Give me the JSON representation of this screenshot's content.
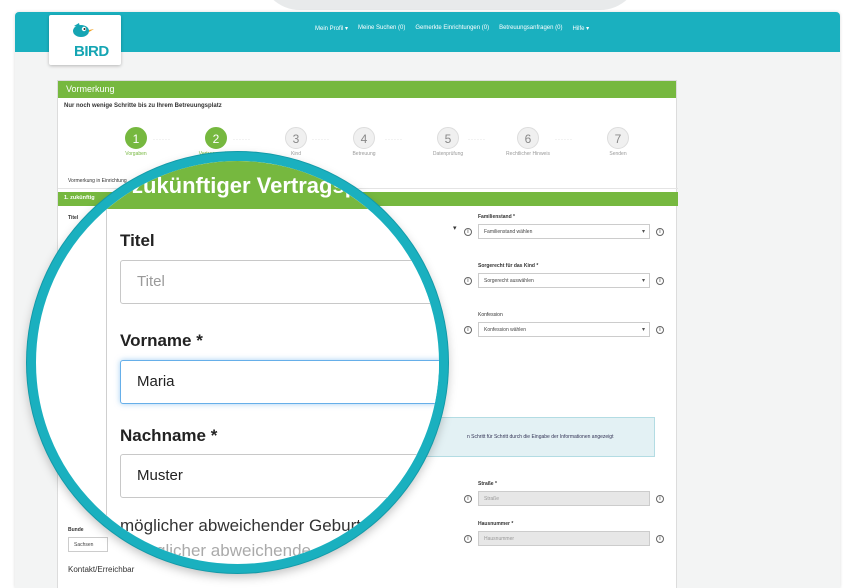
{
  "nav": {
    "logo_text": "BIRD",
    "links": [
      "Mein Profil ▾",
      "Meine Suchen (0)",
      "Gemerkte Einrichtungen (0)",
      "Betreuungsanfragen (0)",
      "Hilfe ▾"
    ]
  },
  "panel": {
    "title": "Vormerkung",
    "subtitle": "Nur noch wenige Schritte bis zu Ihrem Betreuungsplatz",
    "steps": [
      {
        "num": "1",
        "label": "Vorgaben",
        "done": true
      },
      {
        "num": "2",
        "label": "Vertragspartner",
        "done": true
      },
      {
        "num": "3",
        "label": "Kind",
        "done": false
      },
      {
        "num": "4",
        "label": "Betreuung",
        "done": false
      },
      {
        "num": "5",
        "label": "Datenprüfung",
        "done": false
      },
      {
        "num": "6",
        "label": "Rechtlicher Hinweis",
        "done": false
      },
      {
        "num": "7",
        "label": "Senden",
        "done": false
      }
    ],
    "dots": "······",
    "tab": "Vormerkung in Einrichtung",
    "section": "1. zukünftig",
    "left_label_titel": "Titel",
    "bundesland_label": "Bunde",
    "bundesland_value": "Sachsen",
    "kontakt_label": "Kontakt/Erreichbar",
    "fields_right": {
      "familienstand_label": "Familienstand *",
      "familienstand_value": "Familienstand wählen",
      "sorgerecht_label": "Sorgerecht für das Kind *",
      "sorgerecht_value": "Sorgerecht auswählen",
      "konfession_label": "Konfession",
      "konfession_value": "Konfession wählen",
      "strasse_label": "Straße *",
      "strasse_placeholder": "Straße",
      "hausnummer_label": "Hausnummer *",
      "hausnummer_placeholder": "Hausnummer"
    },
    "info_text": "n Schritt für Schritt durch die Eingabe der Informationen angezeigt",
    "info_glyph": "i",
    "caret_glyph": "▾"
  },
  "magnifier": {
    "header": "zukünftiger Vertragsp",
    "titel_label": "Titel",
    "titel_placeholder": "Titel",
    "vorname_label": "Vorname *",
    "vorname_value": "Maria",
    "nachname_label": "Nachname *",
    "nachname_value": "Muster",
    "geburtsname_label": "möglicher abweichender Geburtsna",
    "faded_text": "glicher abweichende",
    "colors": {
      "ring": "#1ab0bf",
      "green": "#76b83f"
    }
  }
}
